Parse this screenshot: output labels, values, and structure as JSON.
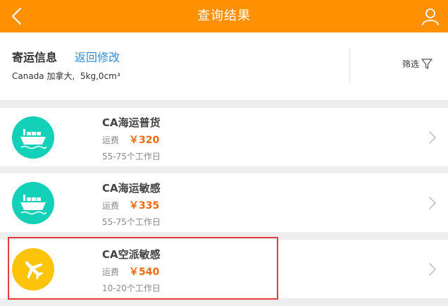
{
  "header": {
    "title": "查询结果"
  },
  "info": {
    "title": "寄运信息",
    "back_edit": "返回修改",
    "details": "Canada 加拿大,  5kg,0cm³",
    "filter_label": "筛选"
  },
  "colors": {
    "header_bg": "#fe9001",
    "sea_icon_bg": "#13d1b8",
    "air_icon_bg": "#fec40a",
    "price": "#f36a0c",
    "link": "#2e8ed6",
    "highlight_border": "#e43d3d"
  },
  "results": [
    {
      "icon": "ship-icon",
      "name": "CA海运普货",
      "fee_label": "运费",
      "price": "￥320",
      "days": "55-75个工作日"
    },
    {
      "icon": "ship-icon",
      "name": "CA海运敏感",
      "fee_label": "运费",
      "price": "￥335",
      "days": "55-75个工作日"
    },
    {
      "icon": "airplane-icon",
      "name": "CA空派敏感",
      "fee_label": "运费",
      "price": "￥540",
      "days": "10-20个工作日"
    }
  ]
}
